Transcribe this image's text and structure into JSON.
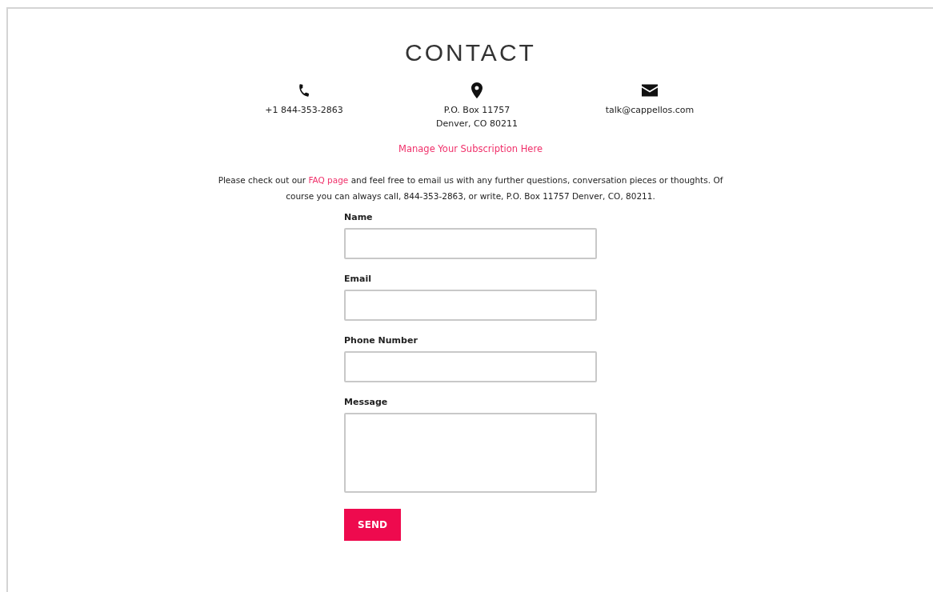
{
  "title": "CONTACT",
  "contacts": [
    {
      "kind": "phone",
      "lines": [
        "+1 844-353-2863"
      ]
    },
    {
      "kind": "location",
      "lines": [
        "P.O. Box 11757",
        "Denver, CO 80211"
      ]
    },
    {
      "kind": "email",
      "lines": [
        "talk@cappellos.com"
      ]
    }
  ],
  "subscription_link": "Manage Your Subscription Here",
  "intro": {
    "before": "Please check out our",
    "link": "FAQ page",
    "after": "and feel free to email us with any further questions, conversation pieces or thoughts. Of course you can always call, 844-353-2863, or write, P.O. Box 11757 Denver, CO, 80211."
  },
  "fields": [
    {
      "label": "Name",
      "kind": "text"
    },
    {
      "label": "Email",
      "kind": "text"
    },
    {
      "label": "Phone Number",
      "kind": "text"
    },
    {
      "label": "Message",
      "kind": "textarea"
    }
  ],
  "submit": "SEND"
}
